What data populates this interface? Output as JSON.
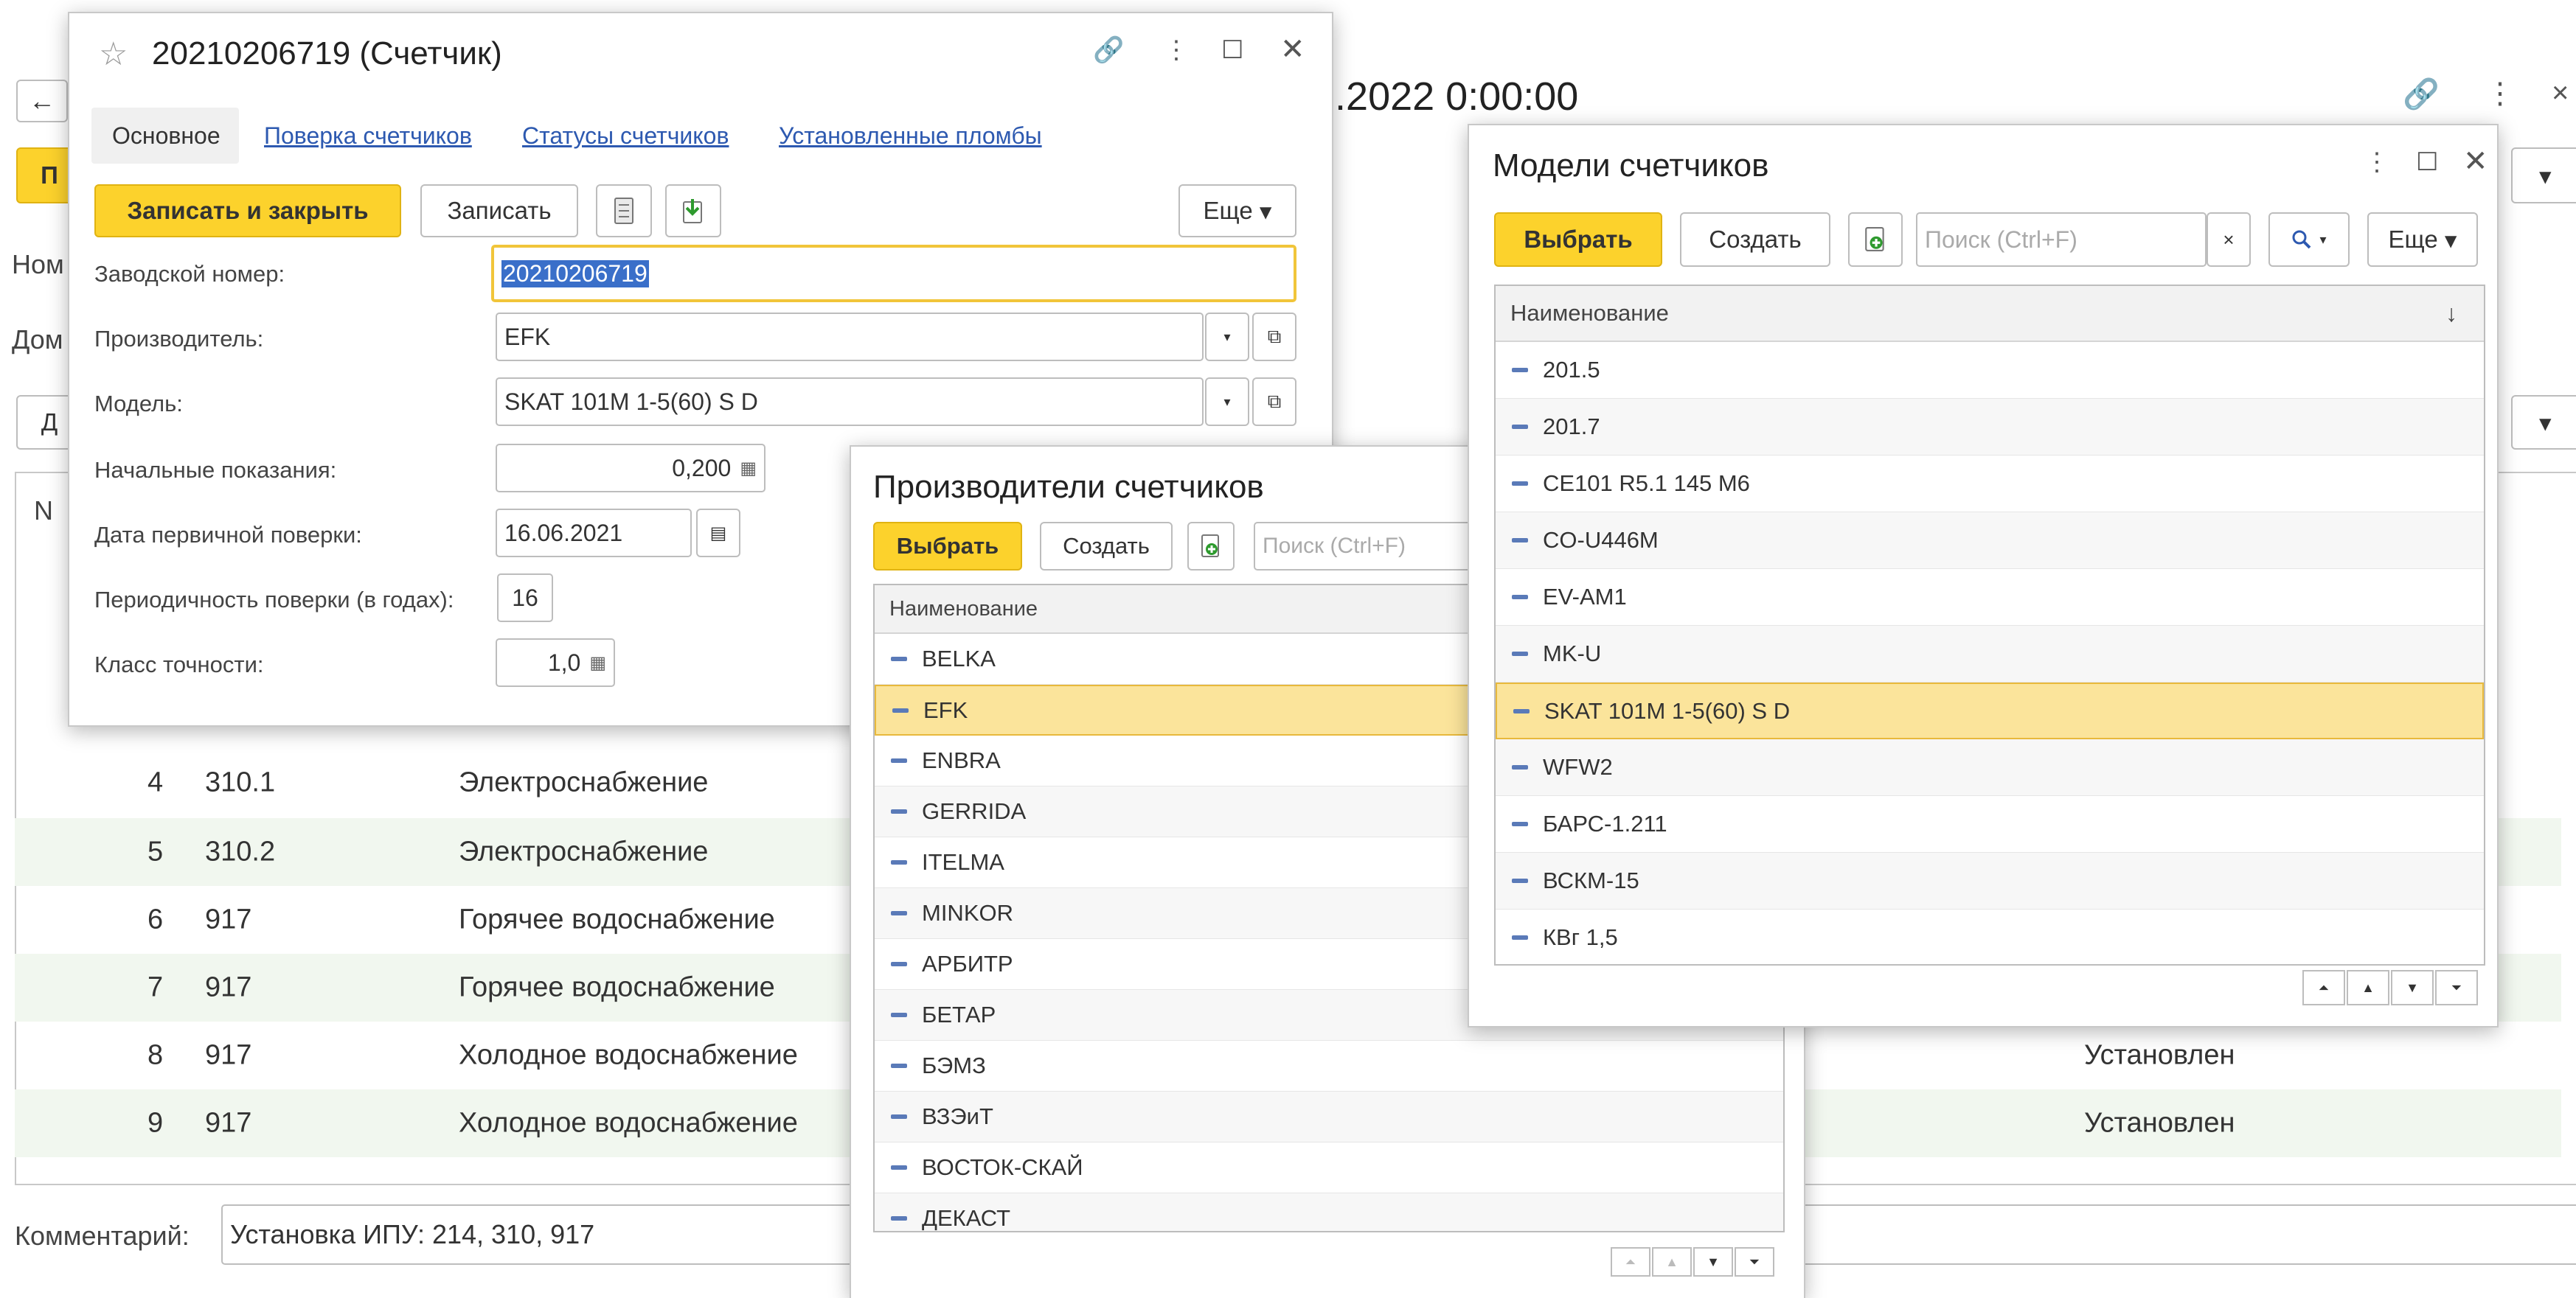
{
  "background": {
    "title": "2.2022 0:00:00",
    "left_labels": [
      "Ном",
      "Дом"
    ],
    "left_buttons": [
      "П",
      "Д"
    ],
    "n_header": "N",
    "rows": [
      {
        "n": "4",
        "code": "310.1",
        "service": "Электроснабжение",
        "status": ""
      },
      {
        "n": "5",
        "code": "310.2",
        "service": "Электроснабжение",
        "status": ""
      },
      {
        "n": "6",
        "code": "917",
        "service": "Горячее водоснабжение",
        "status": ""
      },
      {
        "n": "7",
        "code": "917",
        "service": "Горячее водоснабжение",
        "status": ""
      },
      {
        "n": "8",
        "code": "917",
        "service": "Холодное водоснабжение",
        "status": "Установлен"
      },
      {
        "n": "9",
        "code": "917",
        "service": "Холодное водоснабжение",
        "status": "Установлен"
      }
    ],
    "comment_label": "Комментарий:",
    "comment_value": "Установка ИПУ: 214, 310, 917"
  },
  "meter_form": {
    "title": "20210206719 (Счетчик)",
    "tabs": [
      "Основное",
      "Поверка счетчиков",
      "Статусы счетчиков",
      "Установленные пломбы"
    ],
    "save_close": "Записать и закрыть",
    "save": "Записать",
    "more": "Еще",
    "fields": {
      "serial_label": "Заводской номер:",
      "serial_value": "20210206719",
      "maker_label": "Производитель:",
      "maker_value": "EFK",
      "model_label": "Модель:",
      "model_value": "SKAT 101M 1-5(60) S D",
      "initial_label": "Начальные показания:",
      "initial_value": "0,200",
      "date_label": "Дата первичной поверки:",
      "date_value": "16.06.2021",
      "period_label": "Периодичность поверки (в годах):",
      "period_value": "16",
      "accuracy_label": "Класс точности:",
      "accuracy_value": "1,0"
    }
  },
  "makers_window": {
    "title": "Производители счетчиков",
    "select": "Выбрать",
    "create": "Создать",
    "search_placeholder": "Поиск (Ctrl+F)",
    "column": "Наименование",
    "items": [
      "BELKA",
      "EFK",
      "ENBRA",
      "GERRIDA",
      "ITELMA",
      "MINKOR",
      "АРБИТР",
      "БЕТАР",
      "БЭМЗ",
      "ВЗЭиТ",
      "ВОСТОК-СКАЙ",
      "ДЕКАСТ"
    ],
    "selected": 1
  },
  "models_window": {
    "title": "Модели счетчиков",
    "select": "Выбрать",
    "create": "Создать",
    "search_placeholder": "Поиск (Ctrl+F)",
    "more": "Еще",
    "column": "Наименование",
    "items": [
      "201.5",
      "201.7",
      "CE101 R5.1 145 M6",
      "CO-U446M",
      "EV-AM1",
      "MK-U",
      "SKAT 101M 1-5(60) S D",
      "WFW2",
      "БАРС-1.211",
      "ВСКМ-15",
      "КВг 1,5"
    ],
    "selected": 6
  },
  "colors": {
    "accent_yellow": "#fcd22c",
    "link": "#2d59b0",
    "selection": "#fbe49b"
  }
}
